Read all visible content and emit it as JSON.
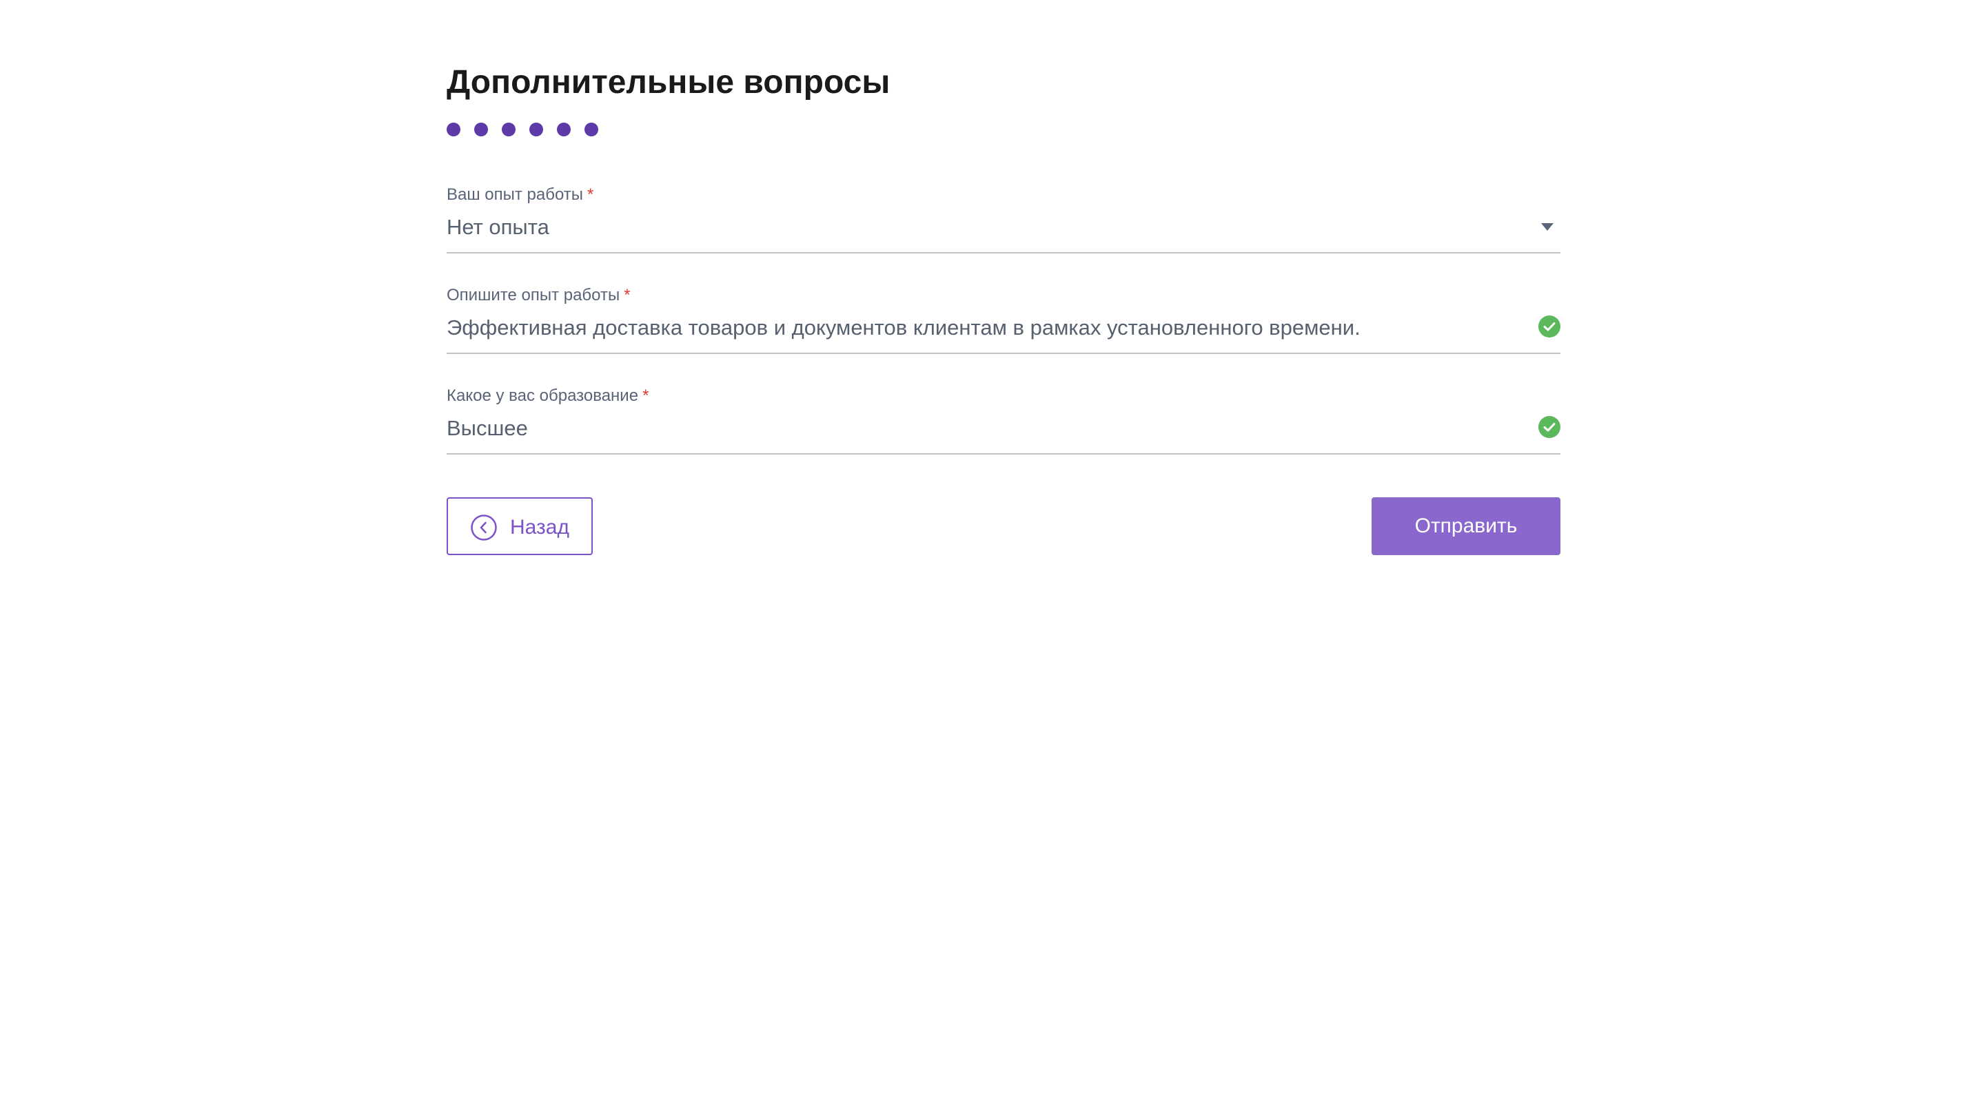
{
  "page": {
    "title": "Дополнительные вопросы"
  },
  "progress": {
    "steps_total": 6,
    "dot_color": "#5c3aa8"
  },
  "colors": {
    "accent": "#7b52c8",
    "required_star": "#e53935",
    "valid_check": "#5cb85c",
    "submit_bg": "#8a67cc"
  },
  "fields": {
    "experience": {
      "label": "Ваш опыт работы",
      "required_mark": "*",
      "value": "Нет опыта",
      "control": "select",
      "icon": "chevron-down-icon"
    },
    "description": {
      "label": "Опишите опыт работы",
      "required_mark": "*",
      "value": "Эффективная доставка товаров и документов клиентам в рамках установленного времени.",
      "control": "text",
      "icon": "check-circle-icon"
    },
    "education": {
      "label": "Какое у вас образование",
      "required_mark": "*",
      "value": "Высшее",
      "control": "text",
      "icon": "check-circle-icon"
    }
  },
  "actions": {
    "back_label": "Назад",
    "back_icon": "chevron-left-circle-icon",
    "submit_label": "Отправить"
  }
}
